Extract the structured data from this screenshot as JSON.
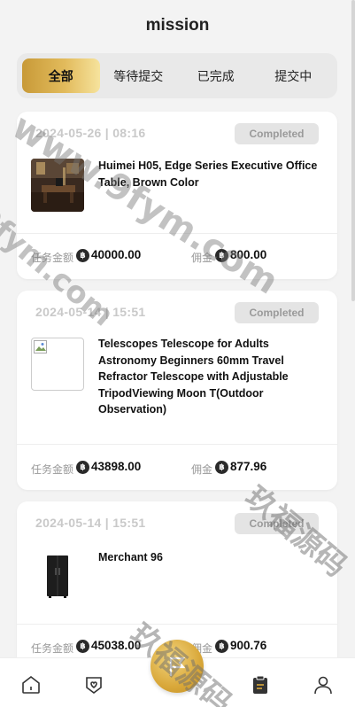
{
  "header": {
    "title": "mission"
  },
  "tabs": [
    {
      "label": "全部",
      "active": true
    },
    {
      "label": "等待提交",
      "active": false
    },
    {
      "label": "已完成",
      "active": false
    },
    {
      "label": "提交中",
      "active": false
    }
  ],
  "tasks": [
    {
      "date": "2024-05-26 | 08:16",
      "status": "Completed",
      "product_name": "Huimei H05, Edge Series Executive Office Table, Brown Color",
      "thumbnail": "office-table-photo",
      "amount_label": "任务金额",
      "amount": "40000.00",
      "commission_label": "佣金",
      "commission": "800.00"
    },
    {
      "date": "2024-05-14 | 15:51",
      "status": "Completed",
      "product_name": "Telescopes Telescope for Adults Astronomy Beginners 60mm Travel Refractor Telescope with Adjustable TripodViewing Moon T(Outdoor Observation)",
      "thumbnail": "broken-image",
      "amount_label": "任务金额",
      "amount": "43898.00",
      "commission_label": "佣金",
      "commission": "877.96"
    },
    {
      "date": "2024-05-14 | 15:51",
      "status": "Completed",
      "product_name": "Merchant 96",
      "thumbnail": "refrigerator-photo",
      "amount_label": "任务金额",
      "amount": "45038.00",
      "commission_label": "佣金",
      "commission": "900.76"
    }
  ],
  "currency_symbol": "฿",
  "bottom_nav": [
    {
      "name": "home",
      "icon": "home-icon"
    },
    {
      "name": "favorites",
      "icon": "heart-shield-icon"
    },
    {
      "name": "mission",
      "icon": "flag-icon"
    },
    {
      "name": "orders",
      "icon": "clipboard-icon"
    },
    {
      "name": "profile",
      "icon": "user-icon"
    }
  ],
  "watermarks": [
    "www.9fym.com",
    "9fym.com",
    "玖福源码"
  ],
  "colors": {
    "accent": "#d9a83a",
    "badge_bg": "#e4e4e4",
    "background": "#f3f3f3"
  }
}
